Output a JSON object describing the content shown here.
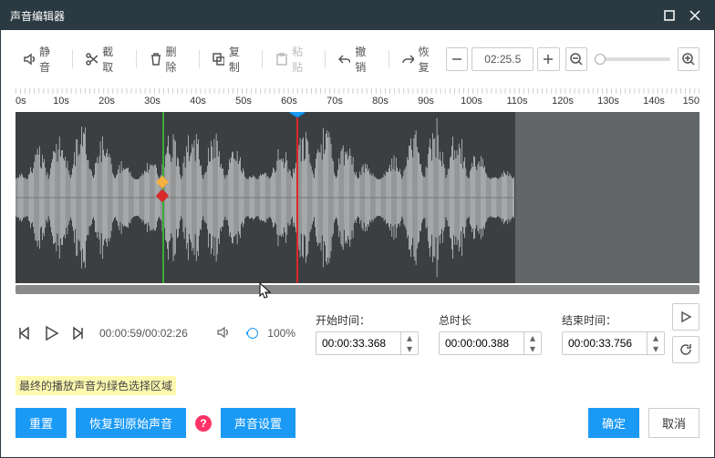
{
  "titlebar": {
    "title": "声音编辑器"
  },
  "toolbar": {
    "mute": "静音",
    "cut": "截取",
    "delete": "删除",
    "copy": "复制",
    "paste": "粘贴",
    "undo": "撤销",
    "redo": "恢复",
    "time_display": "02:25.5"
  },
  "ruler": {
    "labels": [
      "0s",
      "10s",
      "20s",
      "30s",
      "40s",
      "50s",
      "60s",
      "70s",
      "80s",
      "90s",
      "100s",
      "110s",
      "120s",
      "130s",
      "140s",
      "150"
    ],
    "waveform_width_pct": 73,
    "green_marker_pct": 21.5,
    "red_playhead_pct": 41.1,
    "handle_pct": 41.1,
    "scroll_thumb_left_pct": 0,
    "scroll_thumb_width_pct": 100
  },
  "playback": {
    "position": "00:00:59/00:02:26",
    "volume_pct": "100%"
  },
  "time_fields": {
    "start_label": "开始时间：",
    "start_value": "00:00:33.368",
    "duration_label": "总时长",
    "duration_value": "00:00:00.388",
    "end_label": "结束时间：",
    "end_value": "00:00:33.756"
  },
  "hint": "最终的播放声音为绿色选择区域",
  "footer": {
    "reset": "重置",
    "restore": "恢复到原始声音",
    "settings": "声音设置",
    "ok": "确定",
    "cancel": "取消"
  },
  "colors": {
    "accent": "#1b9af5"
  }
}
